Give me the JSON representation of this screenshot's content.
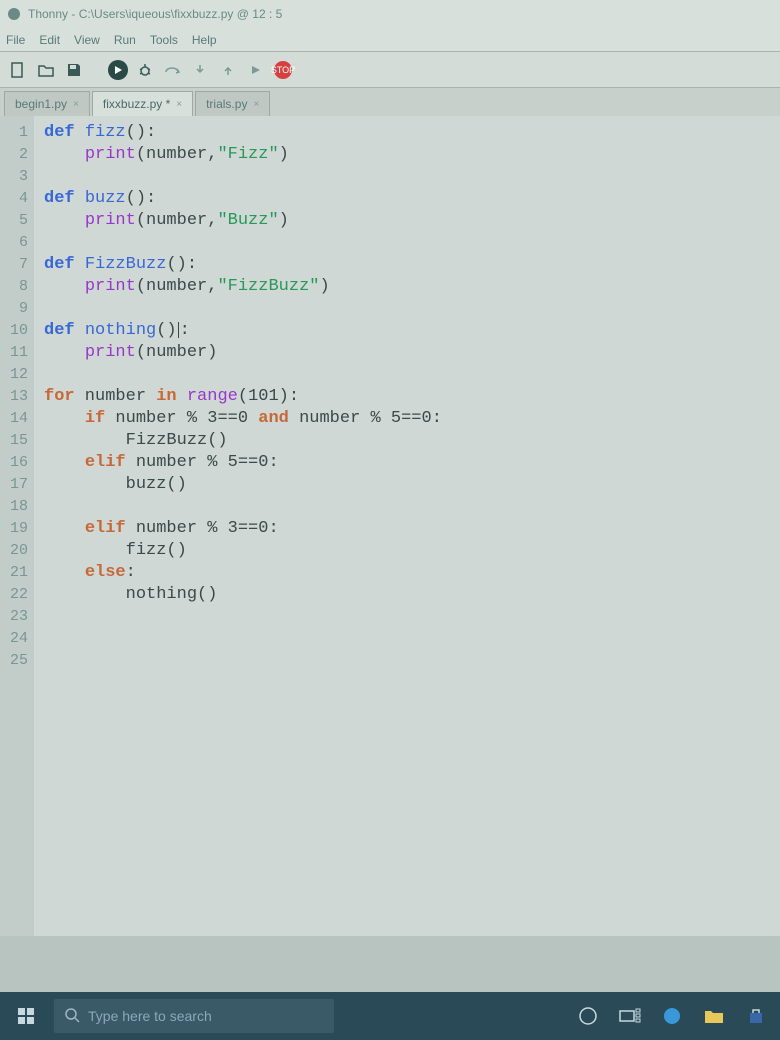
{
  "window": {
    "app_name": "Thonny",
    "file_path": "C:\\Users\\iqueous\\fixxbuzz.py",
    "cursor_pos": "12 : 5"
  },
  "menu": {
    "items": [
      "File",
      "Edit",
      "View",
      "Run",
      "Tools",
      "Help"
    ]
  },
  "toolbar": {
    "stop_label": "STOP"
  },
  "tabs": {
    "list": [
      {
        "label": "begin1.py",
        "active": false
      },
      {
        "label": "fixxbuzz.py *",
        "active": true
      },
      {
        "label": "trials.py",
        "active": false
      }
    ]
  },
  "editor": {
    "line_count": 25,
    "code_plain": "def fizz():\n    print(number,\"Fizz\")\n\ndef buzz():\n    print(number,\"Buzz\")\n\ndef FizzBuzz():\n    print(number,\"FizzBuzz\")\n\ndef nothing():\n    print(number)\n\nfor number in range(101):\n    if number % 3==0 and number % 5==0:\n        FizzBuzz()\n    elif number % 5==0:\n        buzz()\n\n    elif number % 3==0:\n        fizz()\n    else:\n        nothing()\n\n\n",
    "tokens": {
      "def": "def",
      "fizz": "fizz",
      "buzz": "buzz",
      "FizzBuzz": "FizzBuzz",
      "nothing": "nothing",
      "print": "print",
      "number": "number",
      "Fizz_str": "\"Fizz\"",
      "Buzz_str": "\"Buzz\"",
      "FizzBuzz_str": "\"FizzBuzz\"",
      "for": "for",
      "in": "in",
      "range": "range",
      "n101": "101",
      "if": "if",
      "elif": "elif",
      "else": "else",
      "and": "and",
      "n3": "3",
      "n5": "5",
      "n0": "0"
    }
  },
  "taskbar": {
    "search_placeholder": "Type here to search"
  }
}
